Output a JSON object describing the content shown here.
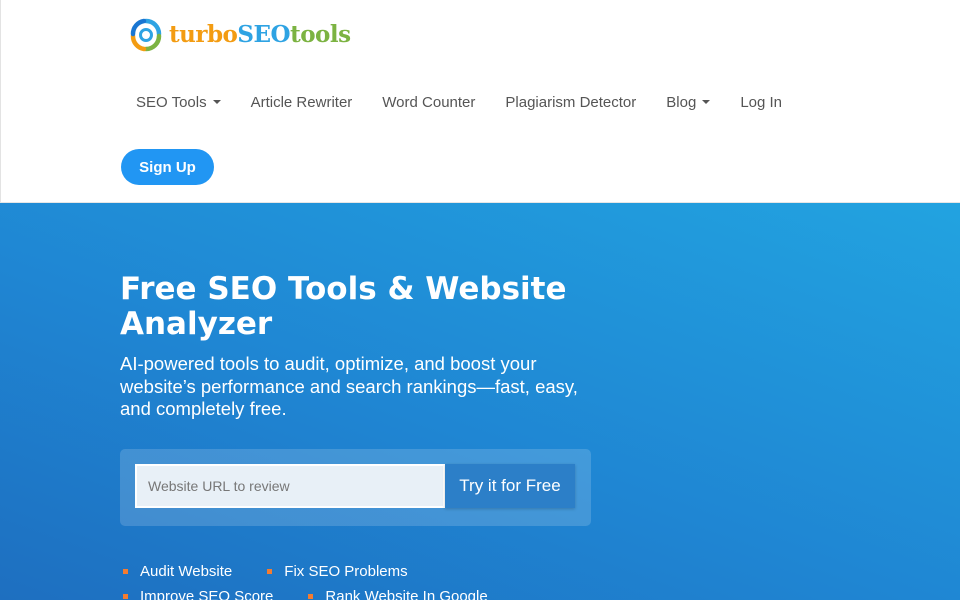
{
  "brand": {
    "part1": "turbo",
    "part2": "SEO",
    "part3": "tools",
    "colors": {
      "turbo": "#f39c12",
      "seo": "#2ea3e3",
      "tools": "#7cb342"
    }
  },
  "nav": {
    "items": [
      {
        "label": "SEO Tools",
        "dropdown": true
      },
      {
        "label": "Article Rewriter",
        "dropdown": false
      },
      {
        "label": "Word Counter",
        "dropdown": false
      },
      {
        "label": "Plagiarism Detector",
        "dropdown": false
      },
      {
        "label": "Blog",
        "dropdown": true
      },
      {
        "label": "Log In",
        "dropdown": false
      }
    ],
    "signup_label": "Sign Up"
  },
  "hero": {
    "title": "Free SEO Tools & Website Analyzer",
    "subtitle": "AI-powered tools to audit, optimize, and boost your website’s performance and search rankings—fast, easy, and completely free.",
    "input_placeholder": "Website URL to review",
    "input_value": "",
    "button_label": "Try it for Free",
    "features": [
      "Audit Website",
      "Fix SEO Problems",
      "Improve SEO Score",
      "Rank Website In Google"
    ]
  },
  "colors": {
    "accent": "#2196f3",
    "hero_gradient_start": "#1e6fc0",
    "hero_gradient_end": "#22a3e0",
    "bullet": "#f47c30"
  }
}
